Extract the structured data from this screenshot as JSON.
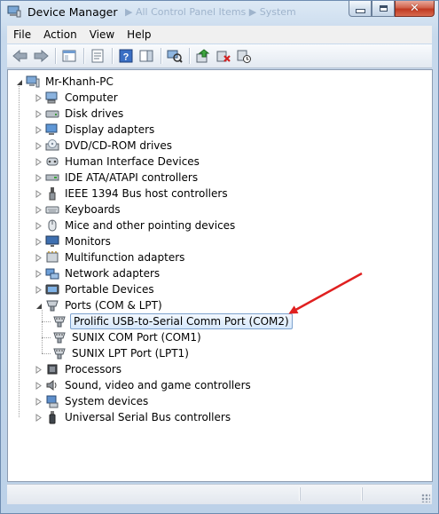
{
  "window": {
    "title": "Device Manager",
    "ghost_breadcrumb": "▶  All Control Panel Items  ▶  System"
  },
  "menu": [
    "File",
    "Action",
    "View",
    "Help"
  ],
  "toolbar": [
    "back-icon",
    "forward-icon",
    "sep",
    "show-hide-tree-icon",
    "sep",
    "properties-icon",
    "sep",
    "help-icon",
    "update-driver-icon",
    "sep",
    "scan-hardware-icon",
    "sep",
    "update-driver-software-icon",
    "uninstall-icon",
    "disable-icon"
  ],
  "tree": {
    "root": "Mr-Khanh-PC",
    "categories": [
      {
        "label": "Computer",
        "icon": "computer-icon"
      },
      {
        "label": "Disk drives",
        "icon": "disk-drive-icon"
      },
      {
        "label": "Display adapters",
        "icon": "display-adapter-icon"
      },
      {
        "label": "DVD/CD-ROM drives",
        "icon": "dvd-icon"
      },
      {
        "label": "Human Interface Devices",
        "icon": "hid-icon"
      },
      {
        "label": "IDE ATA/ATAPI controllers",
        "icon": "ide-icon"
      },
      {
        "label": "IEEE 1394 Bus host controllers",
        "icon": "ieee1394-icon"
      },
      {
        "label": "Keyboards",
        "icon": "keyboard-icon"
      },
      {
        "label": "Mice and other pointing devices",
        "icon": "mouse-icon"
      },
      {
        "label": "Monitors",
        "icon": "monitor-icon"
      },
      {
        "label": "Multifunction adapters",
        "icon": "multifunction-icon"
      },
      {
        "label": "Network adapters",
        "icon": "network-adapter-icon"
      },
      {
        "label": "Portable Devices",
        "icon": "portable-device-icon"
      },
      {
        "label": "Ports (COM & LPT)",
        "icon": "port-icon",
        "expanded": true
      },
      {
        "label": "Processors",
        "icon": "processor-icon"
      },
      {
        "label": "Sound, video and game controllers",
        "icon": "sound-icon"
      },
      {
        "label": "System devices",
        "icon": "system-device-icon"
      },
      {
        "label": "Universal Serial Bus controllers",
        "icon": "usb-icon"
      }
    ],
    "ports_children": [
      {
        "label": "Prolific USB-to-Serial Comm Port (COM2)",
        "selected": true
      },
      {
        "label": "SUNIX COM Port (COM1)"
      },
      {
        "label": "SUNIX LPT Port (LPT1)"
      }
    ]
  },
  "colors": {
    "annotation_arrow": "#e02020",
    "selection_border": "#7da2ce"
  }
}
